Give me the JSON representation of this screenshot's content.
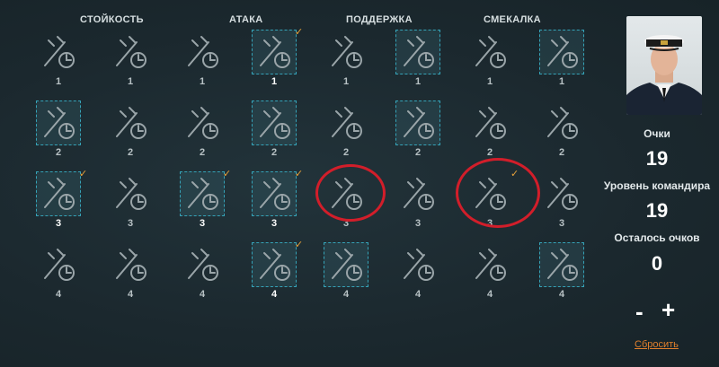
{
  "categories": [
    "СТОЙКОСТЬ",
    "АТАКА",
    "ПОДДЕРЖКА",
    "СМЕКАЛКА"
  ],
  "skills": [
    [
      {
        "tier": "1",
        "icon": "warning-tank-icon",
        "selected": false,
        "check": false
      },
      {
        "tier": "1",
        "icon": "no-fire-icon",
        "selected": false,
        "check": false
      },
      {
        "tier": "1",
        "icon": "torpedo-timer-icon",
        "selected": false,
        "check": false
      },
      {
        "tier": "1",
        "icon": "plane-target-icon",
        "selected": true,
        "check": true
      },
      {
        "tier": "1",
        "icon": "plane-crosshair-icon",
        "selected": false,
        "check": false
      },
      {
        "tier": "1",
        "icon": "hull-upgrade-icon",
        "selected": true,
        "check": false
      },
      {
        "tier": "1",
        "icon": "shell-warning-icon",
        "selected": false,
        "check": false
      },
      {
        "tier": "1",
        "icon": "repair-plus-icon",
        "selected": true,
        "check": false
      }
    ],
    [
      {
        "tier": "2",
        "icon": "wrench-timer-icon",
        "selected": true,
        "check": false
      },
      {
        "tier": "2",
        "icon": "stopwatch-icon",
        "selected": false,
        "check": false
      },
      {
        "tier": "2",
        "icon": "turret-upgrade-icon",
        "selected": false,
        "check": false
      },
      {
        "tier": "2",
        "icon": "torpedo-upgrade-icon",
        "selected": true,
        "check": false
      },
      {
        "tier": "2",
        "icon": "smoke-upgrade-icon",
        "selected": false,
        "check": false
      },
      {
        "tier": "2",
        "icon": "plane-upgrade-icon",
        "selected": true,
        "check": false
      },
      {
        "tier": "2",
        "icon": "shells-timer-icon",
        "selected": false,
        "check": false
      },
      {
        "tier": "2",
        "icon": "gears-icon",
        "selected": false,
        "check": false
      }
    ],
    [
      {
        "tier": "3",
        "icon": "wrench-upgrade-icon",
        "selected": true,
        "check": true
      },
      {
        "tier": "3",
        "icon": "ship-upgrade-icon",
        "selected": false,
        "check": false
      },
      {
        "tier": "3",
        "icon": "shells-timer-icon",
        "selected": true,
        "check": true
      },
      {
        "tier": "3",
        "icon": "plane-fire-icon",
        "selected": true,
        "check": true
      },
      {
        "tier": "3",
        "icon": "aa-upgrade-icon",
        "selected": false,
        "check": false
      },
      {
        "tier": "3",
        "icon": "aa-plus-icon",
        "selected": false,
        "check": false
      },
      {
        "tier": "3",
        "icon": "shell-fire-icon",
        "selected": false,
        "check": true
      },
      {
        "tier": "3",
        "icon": "torpedo-warning-icon",
        "selected": false,
        "check": false
      }
    ],
    [
      {
        "tier": "4",
        "icon": "armor-upgrade-icon",
        "selected": false,
        "check": false
      },
      {
        "tier": "4",
        "icon": "extinguisher-icon",
        "selected": false,
        "check": false
      },
      {
        "tier": "4",
        "icon": "crossed-torpedo-icon",
        "selected": false,
        "check": false
      },
      {
        "tier": "4",
        "icon": "plane-formation-icon",
        "selected": true,
        "check": true
      },
      {
        "tier": "4",
        "icon": "aa-defense-icon",
        "selected": true,
        "check": false
      },
      {
        "tier": "4",
        "icon": "aa-sight-icon",
        "selected": false,
        "check": false
      },
      {
        "tier": "4",
        "icon": "radar-icon",
        "selected": false,
        "check": false
      },
      {
        "tier": "4",
        "icon": "alert-down-icon",
        "selected": true,
        "check": false
      }
    ]
  ],
  "panel": {
    "points_label": "Очки",
    "points_value": "19",
    "level_label": "Уровень командира",
    "level_value": "19",
    "remaining_label": "Осталось очков",
    "remaining_value": "0",
    "minus": "-",
    "plus": "+",
    "reset": "Сбросить"
  },
  "colors": {
    "background": "#1d2b31",
    "selected_border": "#35a3b8",
    "check": "#e8a23a",
    "highlight_ring": "#d21e2a",
    "reset_link": "#e07f2c"
  }
}
